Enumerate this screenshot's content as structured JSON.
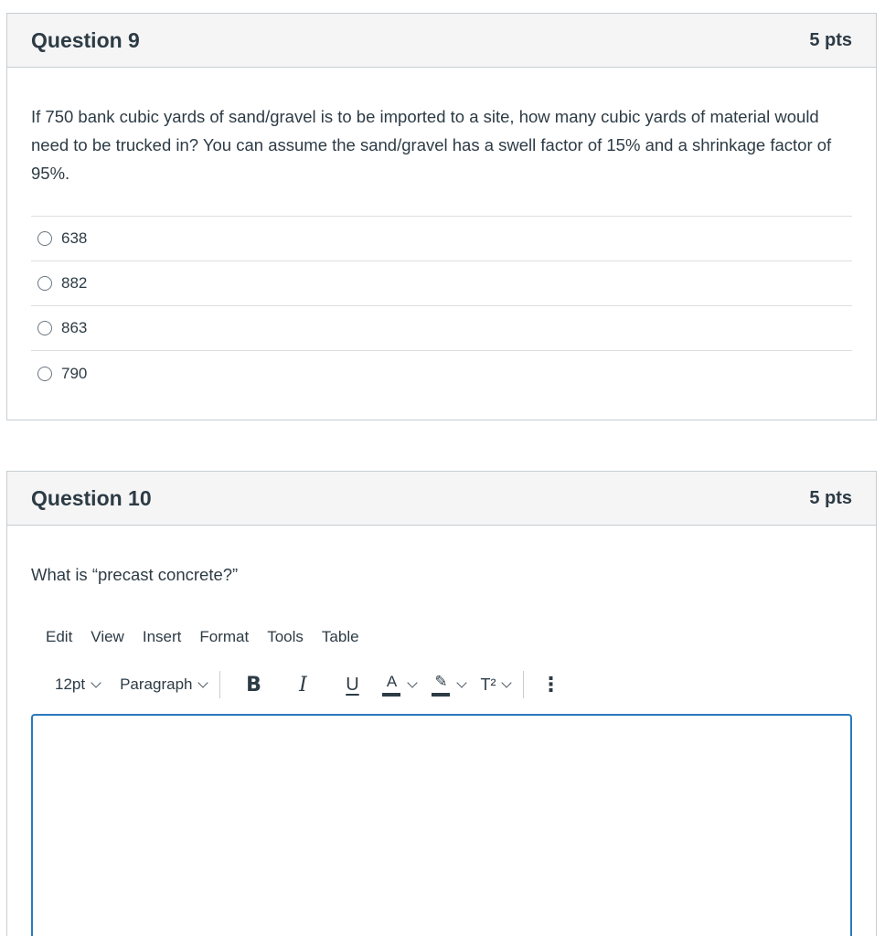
{
  "q9": {
    "title": "Question 9",
    "points": "5 pts",
    "text": "If 750 bank cubic yards of sand/gravel is to be imported to a site, how many cubic yards of material would need to be trucked in?  You can assume the sand/gravel has a swell factor of 15% and a shrinkage factor of 95%.",
    "answers": [
      "638",
      "882",
      "863",
      "790"
    ]
  },
  "q10": {
    "title": "Question 10",
    "points": "5 pts",
    "text": "What is “precast concrete?”",
    "menu": [
      "Edit",
      "View",
      "Insert",
      "Format",
      "Tools",
      "Table"
    ],
    "toolbar": {
      "font_size": "12pt",
      "block_format": "Paragraph",
      "bold": "B",
      "italic": "I",
      "underline": "U",
      "text_color": "A",
      "highlight": "✎",
      "superscript": "T²",
      "more": "⋮"
    },
    "editor_value": ""
  },
  "colors": {
    "accent": "#2b7abc",
    "text": "#2d3b45",
    "border": "#c7cdd1",
    "header_bg": "#f5f5f5"
  }
}
